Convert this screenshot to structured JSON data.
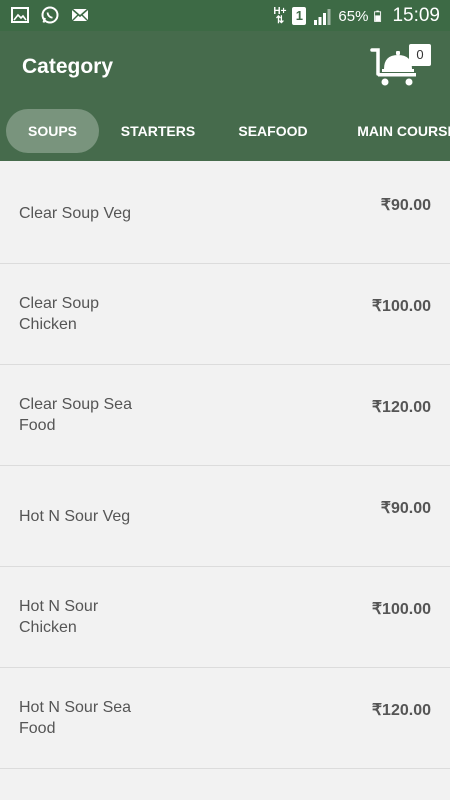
{
  "status_bar": {
    "network_type_top": "H+",
    "network_type_bottom": "⇅",
    "sim_slot": "1",
    "battery": "65%",
    "time": "15:09",
    "icons": [
      "gallery-icon",
      "whatsapp-icon",
      "mail-icon",
      "signal-icon",
      "battery-icon"
    ]
  },
  "app_bar": {
    "title": "Category",
    "cart_count": "0",
    "cart_icon": "cart-icon"
  },
  "tabs": [
    {
      "label": "SOUPS",
      "active": true
    },
    {
      "label": "STARTERS",
      "active": false
    },
    {
      "label": "SEAFOOD",
      "active": false
    },
    {
      "label": "MAIN COURSE",
      "active": false
    }
  ],
  "items": [
    {
      "name": "Clear Soup Veg",
      "price": "₹90.00"
    },
    {
      "name": "Clear Soup Chicken",
      "price": "₹100.00"
    },
    {
      "name": "Clear Soup Sea Food",
      "price": "₹120.00"
    },
    {
      "name": "Hot N Sour Veg",
      "price": "₹90.00"
    },
    {
      "name": "Hot N Sour Chicken",
      "price": "₹100.00"
    },
    {
      "name": "Hot N Sour Sea Food",
      "price": "₹120.00"
    }
  ],
  "colors": {
    "app_bar": "#466b4c",
    "status_bar": "#3d6a45",
    "background": "#f2f2f2",
    "text": "#555555"
  }
}
